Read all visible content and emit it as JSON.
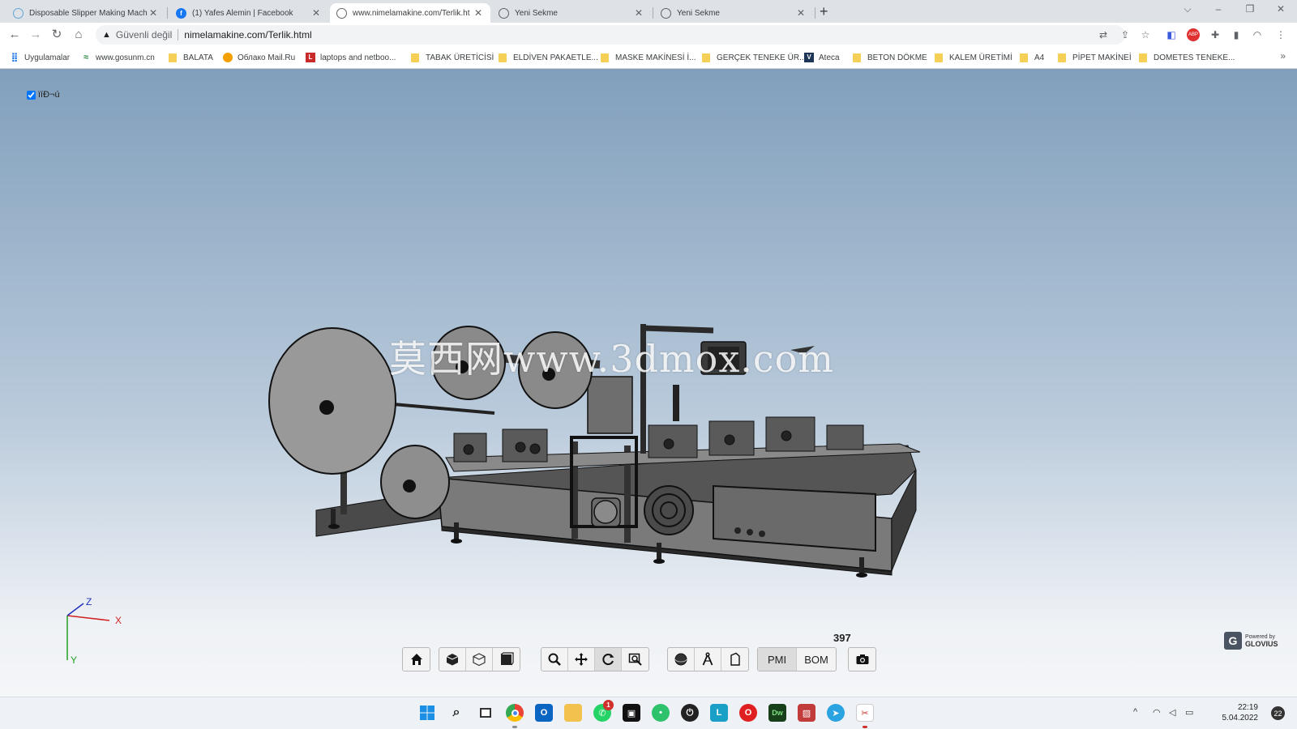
{
  "browser": {
    "tabs": [
      {
        "title": "Disposable Slipper Making Mach",
        "icon": "globe-icon",
        "active": false
      },
      {
        "title": "(1) Yafes Alemin | Facebook",
        "icon": "facebook-icon",
        "active": false
      },
      {
        "title": "www.nimelamakine.com/Terlik.ht",
        "icon": "globe-icon",
        "active": true
      },
      {
        "title": "Yeni Sekme",
        "icon": "chrome-icon",
        "active": false
      },
      {
        "title": "Yeni Sekme",
        "icon": "chrome-icon",
        "active": false
      }
    ],
    "new_tab": "+",
    "window_controls": {
      "collapse": "⌵",
      "minimize": "–",
      "restore": "❐",
      "close": "✕"
    },
    "address": {
      "security_label": "Güvenli değil",
      "url": "nimelamakine.com/Terlik.html"
    },
    "bookmarks": [
      {
        "label": "Uygulamalar",
        "icon": "apps-grid-icon"
      },
      {
        "label": "www.gosunm.cn",
        "icon": "site-icon"
      },
      {
        "label": "BALATA",
        "icon": "folder-icon"
      },
      {
        "label": "Облако Mail.Ru",
        "icon": "mailru-icon"
      },
      {
        "label": "laptops and netboo...",
        "icon": "l-site-icon"
      },
      {
        "label": "TABAK ÜRETİCİSİ",
        "icon": "folder-icon"
      },
      {
        "label": "ELDİVEN PAKAETLE...",
        "icon": "folder-icon"
      },
      {
        "label": "MASKE MAKİNESİ İ...",
        "icon": "folder-icon"
      },
      {
        "label": "GERÇEK TENEKE ÜR...",
        "icon": "folder-icon"
      },
      {
        "label": "Ateca",
        "icon": "vw-icon"
      },
      {
        "label": "BETON DÖKME",
        "icon": "folder-icon"
      },
      {
        "label": "KALEM ÜRETİMİ",
        "icon": "folder-icon"
      },
      {
        "label": "A4",
        "icon": "folder-icon"
      },
      {
        "label": "PİPET MAKİNEİ",
        "icon": "folder-icon"
      },
      {
        "label": "DOMETES TENEKE...",
        "icon": "folder-icon"
      }
    ],
    "bookmarks_more": "»"
  },
  "viewer": {
    "tree_label": "ïíÐ¬ú",
    "tree_checked": true,
    "watermark": "莫西网www.3dmox.com",
    "axes": {
      "x": "X",
      "y": "Y",
      "z": "Z"
    },
    "bom_count": "397",
    "toolbar": {
      "pmi_label": "PMI",
      "bom_label": "BOM"
    },
    "branding": {
      "powered_by": "Powered by",
      "name": "GLOVIUS",
      "logo": "G"
    }
  },
  "taskbar": {
    "time": "22:19",
    "date": "5.04.2022",
    "notifications": "22",
    "whatsapp_badge": "1"
  },
  "colors": {
    "viewer_top": "#819fbc",
    "viewer_bottom": "#f4f6f8",
    "tabstrip": "#dee1e6",
    "axis_x": "#d02020",
    "axis_y": "#20a020",
    "axis_z": "#2030c0"
  }
}
